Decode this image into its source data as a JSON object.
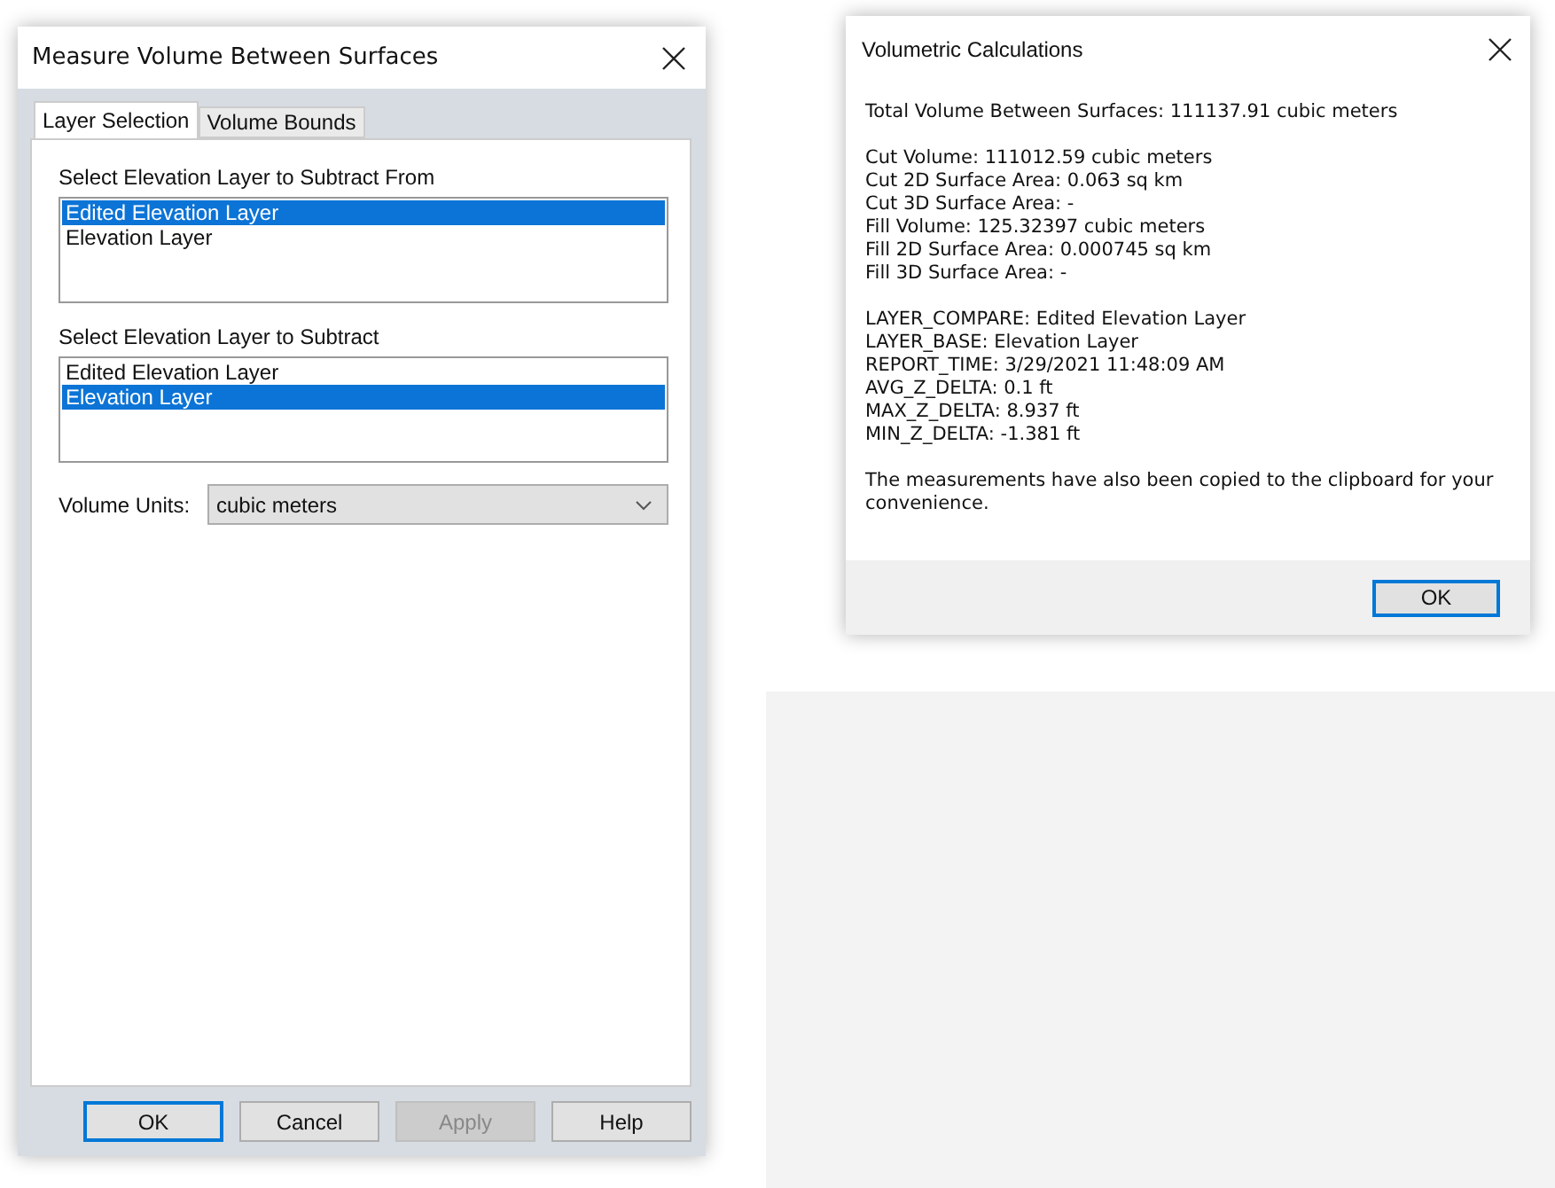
{
  "measure_dialog": {
    "title": "Measure Volume Between Surfaces",
    "tabs": [
      {
        "label": "Layer Selection",
        "selected": true
      },
      {
        "label": "Volume Bounds",
        "selected": false
      }
    ],
    "lists": [
      {
        "label": "Select Elevation Layer to Subtract From",
        "items": [
          {
            "text": "Edited Elevation Layer",
            "selected": true
          },
          {
            "text": "Elevation Layer",
            "selected": false
          }
        ]
      },
      {
        "label": "Select Elevation Layer to Subtract",
        "items": [
          {
            "text": "Edited Elevation Layer",
            "selected": false
          },
          {
            "text": "Elevation Layer",
            "selected": true
          }
        ]
      }
    ],
    "volume_units": {
      "label": "Volume Units:",
      "value": "cubic meters"
    },
    "buttons": [
      {
        "label": "OK",
        "default": true,
        "disabled": false
      },
      {
        "label": "Cancel",
        "default": false,
        "disabled": false
      },
      {
        "label": "Apply",
        "default": false,
        "disabled": true
      },
      {
        "label": "Help",
        "default": false,
        "disabled": false
      }
    ]
  },
  "results_dialog": {
    "title": "Volumetric Calculations",
    "paragraphs": [
      [
        "Total Volume Between Surfaces: 111137.91 cubic meters"
      ],
      [
        "Cut Volume: 111012.59 cubic meters",
        "Cut 2D Surface Area: 0.063 sq km",
        "Cut 3D Surface Area: -",
        "Fill Volume: 125.32397 cubic meters",
        "Fill 2D Surface Area: 0.000745 sq km",
        "Fill 3D Surface Area: -"
      ],
      [
        "LAYER_COMPARE: Edited Elevation Layer",
        "LAYER_BASE: Elevation Layer",
        "REPORT_TIME: 3/29/2021 11:48:09 AM",
        "AVG_Z_DELTA: 0.1 ft",
        "MAX_Z_DELTA: 8.937 ft",
        "MIN_Z_DELTA: -1.381 ft"
      ],
      [
        "The measurements have also been copied to the clipboard for your convenience."
      ]
    ],
    "buttons": [
      {
        "label": "OK",
        "default": true,
        "disabled": false
      }
    ]
  }
}
